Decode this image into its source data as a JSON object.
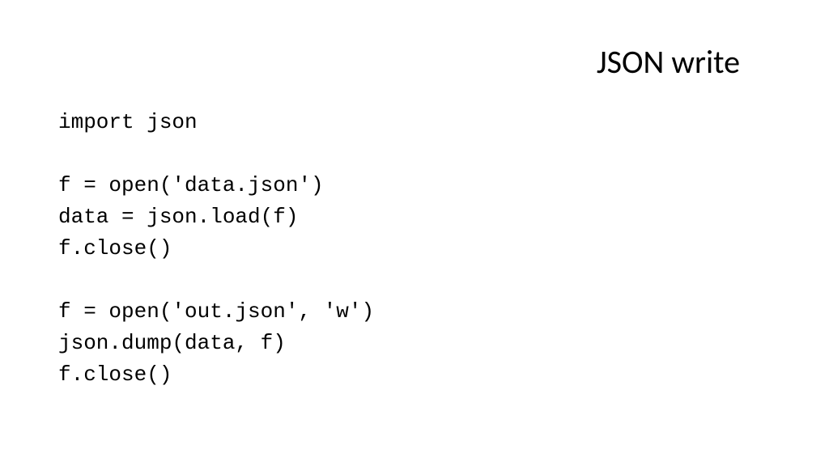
{
  "slide": {
    "title": "JSON write",
    "code": "import json\n\nf = open('data.json')\ndata = json.load(f)\nf.close()\n\nf = open('out.json', 'w')\njson.dump(data, f)\nf.close()"
  }
}
